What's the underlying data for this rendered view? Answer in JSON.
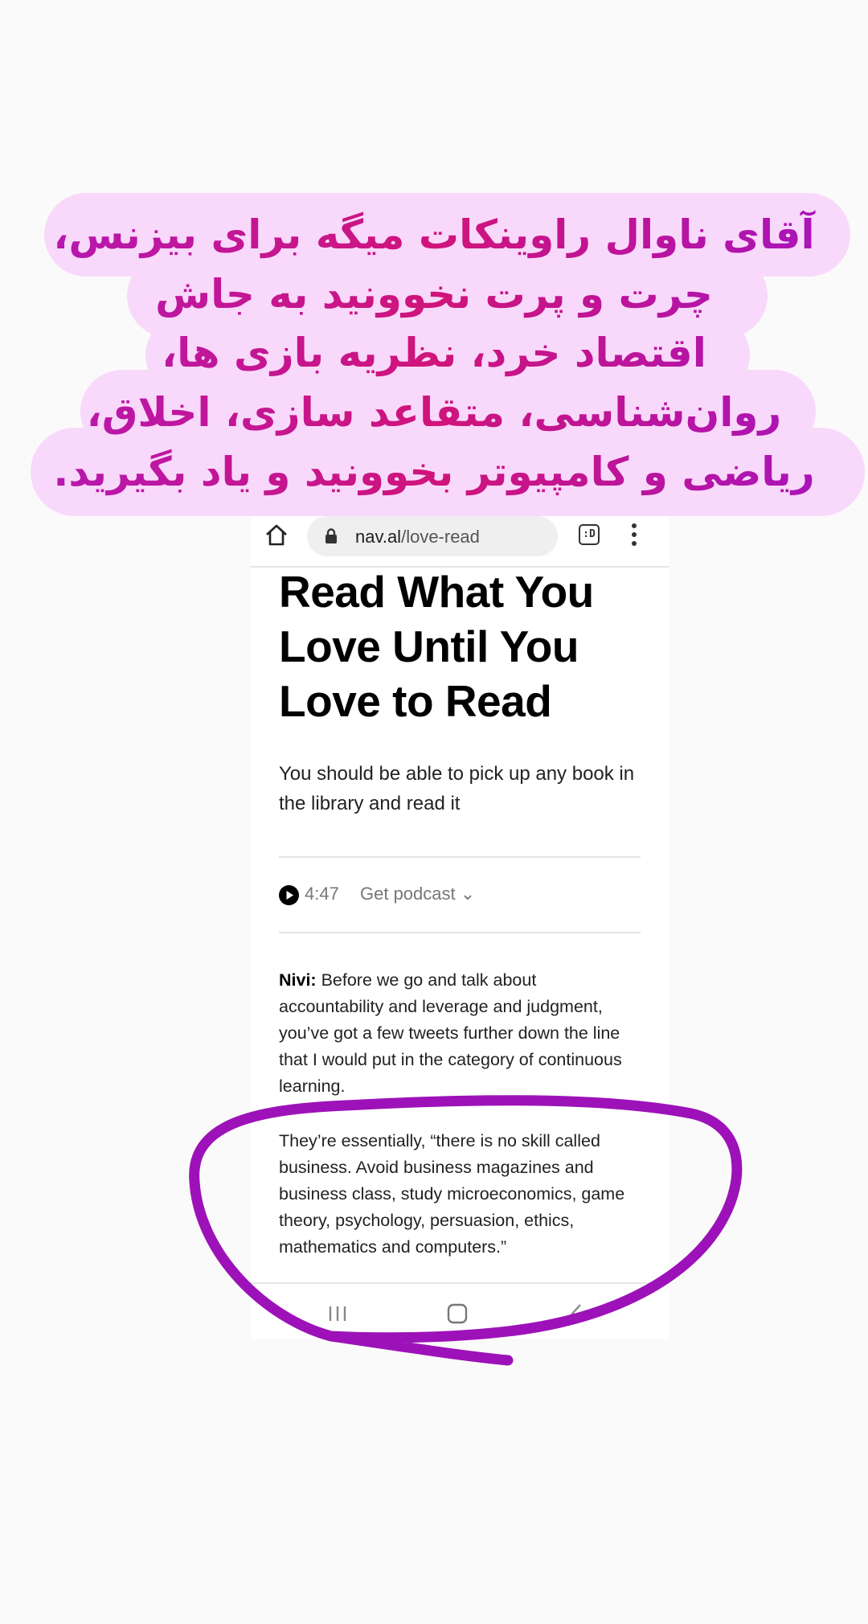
{
  "caption": {
    "lines": [
      "آقای ناوال راوینکات میگه برای بیزنس،",
      "چرت و پرت نخوونید به جاش",
      "اقتصاد خرد، نظریه بازی ها،",
      "روان‌شناسی، متقاعد سازی، اخلاق،",
      "ریاضی و کامپیوتر بخوونید و یاد بگیرید."
    ]
  },
  "browser": {
    "url_domain": "nav.al",
    "url_path": "/love-read",
    "tabs_label": ":D",
    "icons": [
      "home-icon",
      "lock-icon",
      "tab-switcher-icon",
      "more-vert-icon"
    ]
  },
  "article": {
    "title": "Read What You Love Until You Love to Read",
    "subtitle": "You should be able to pick up any book in the library and read it",
    "podcast": {
      "duration": "4:47",
      "get_label": "Get podcast ⌄"
    },
    "para1": {
      "speaker": "Nivi:",
      "text": " Before we go and talk about accountability and leverage and judgment, you’ve got a few tweets further down the line that I would put in the category of continuous learning."
    },
    "para2": "They’re essentially, “there is no skill called business. Avoid business magazines and business class, study microeconomics, game theory, psychology, persuasion, ethics, mathematics and computers.”"
  },
  "navbar": {
    "icons": [
      "recent-apps-icon",
      "home-icon",
      "back-icon"
    ]
  },
  "colors": {
    "bubble": "#f9d9fb",
    "caption_magenta": "#d0147a",
    "caption_purple": "#a414c2",
    "annotation_stroke": "#9d12b8"
  }
}
